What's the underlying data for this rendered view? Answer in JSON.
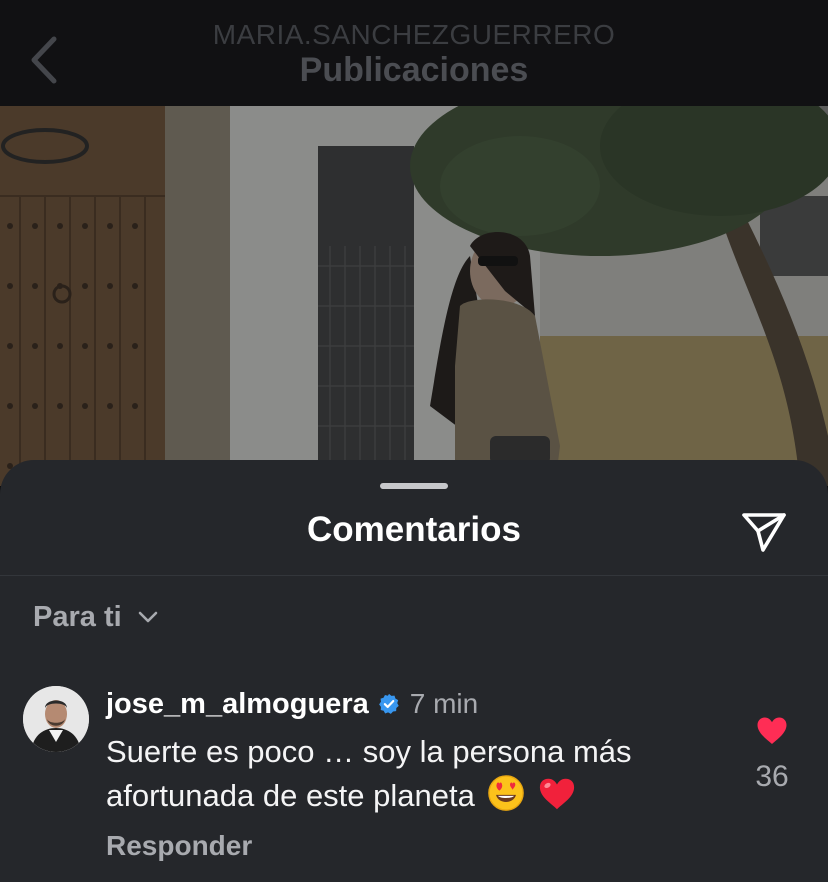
{
  "header": {
    "username": "MARIA.SANCHEZGUERRERO",
    "title": "Publicaciones",
    "back_icon": "chevron-left-icon"
  },
  "sheet": {
    "title": "Comentarios",
    "send_icon": "paper-plane-icon",
    "filter_label": "Para ti",
    "filter_icon": "chevron-down-icon"
  },
  "comments": [
    {
      "username": "jose_m_almoguera",
      "verified": true,
      "time": "7 min",
      "text": "Suerte es poco … soy la persona más afortunada de este planeta",
      "emojis": [
        "smiling-face-with-heart-eyes",
        "red-heart"
      ],
      "reply_label": "Responder",
      "liked": true,
      "like_count": "36"
    }
  ],
  "colors": {
    "sheet_bg": "#25272b",
    "like_red": "#ff2d55",
    "verified_blue": "#3897f0",
    "muted_text": "#a8aaaf"
  }
}
